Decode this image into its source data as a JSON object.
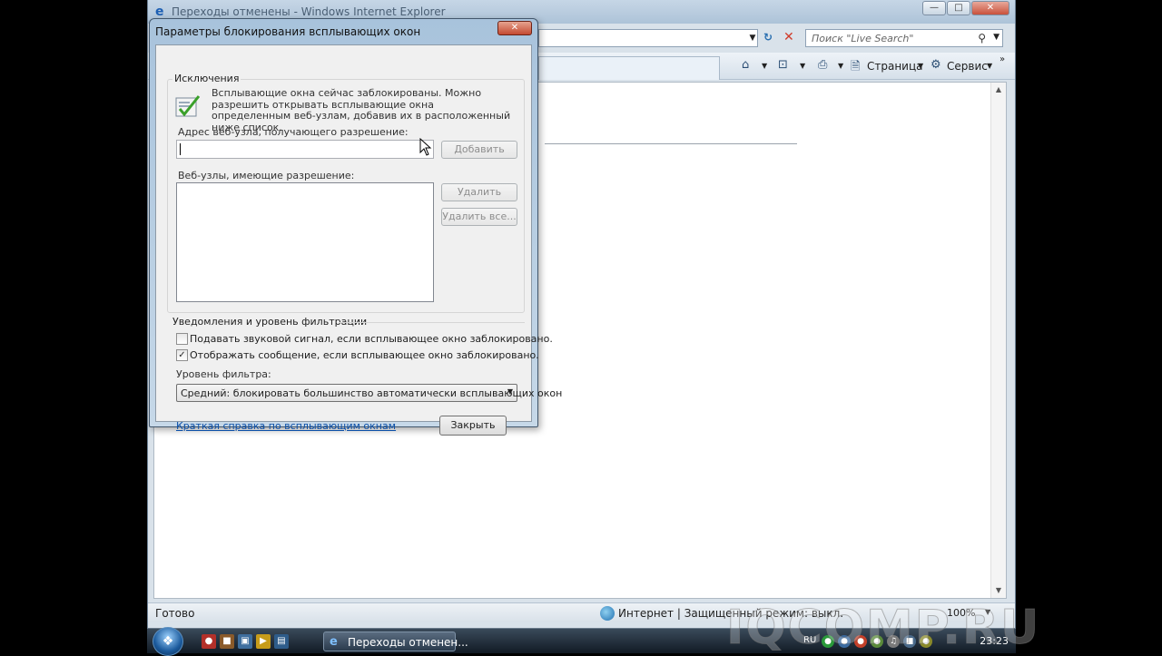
{
  "ie_window": {
    "title": "Переходы отменены - Windows Internet Explorer",
    "search_placeholder": "Поиск \"Live Search\"",
    "command_bar": {
      "page_label": "Страница",
      "tools_label": "Сервис"
    },
    "status": {
      "text": "Готово",
      "zone": "Интернет | Защищенный режим: выкл.",
      "zoom": "100%"
    }
  },
  "dialog": {
    "title": "Параметры блокирования всплывающих окон",
    "exceptions_group": "Исключения",
    "info_text": "Всплывающие окна сейчас заблокированы.  Можно разрешить открывать всплывающие окна определенным веб-узлам, добавив их в расположенный ниже список.",
    "address_label": "Адрес веб-узла, получающего разрешение:",
    "address_value": "",
    "add_button": "Добавить",
    "allowed_label": "Веб-узлы, имеющие разрешение:",
    "allowed_sites": [],
    "remove_button": "Удалить",
    "remove_all_button": "Удалить все...",
    "notifications_group": "Уведомления и  уровень фильтрации",
    "sound_checkbox": {
      "label": "Подавать звуковой сигнал, если всплывающее окно заблокировано.",
      "checked": false
    },
    "infobar_checkbox": {
      "label": "Отображать сообщение, если всплывающее окно заблокировано.",
      "checked": true
    },
    "filter_label": "Уровень фильтра:",
    "filter_value": "Средний: блокировать большинство автоматически всплывающих окон",
    "help_link": "Краткая справка по всплывающим окнам",
    "close_button": "Закрыть"
  },
  "taskbar": {
    "task_label": "Переходы отменен...",
    "language": "RU",
    "clock": "23:23"
  },
  "watermark": "IQCOMP.RU",
  "colors": {
    "dialog_frame": "#a8c3dc",
    "link": "#0b4fa8",
    "taskbar": "#1a2633"
  }
}
